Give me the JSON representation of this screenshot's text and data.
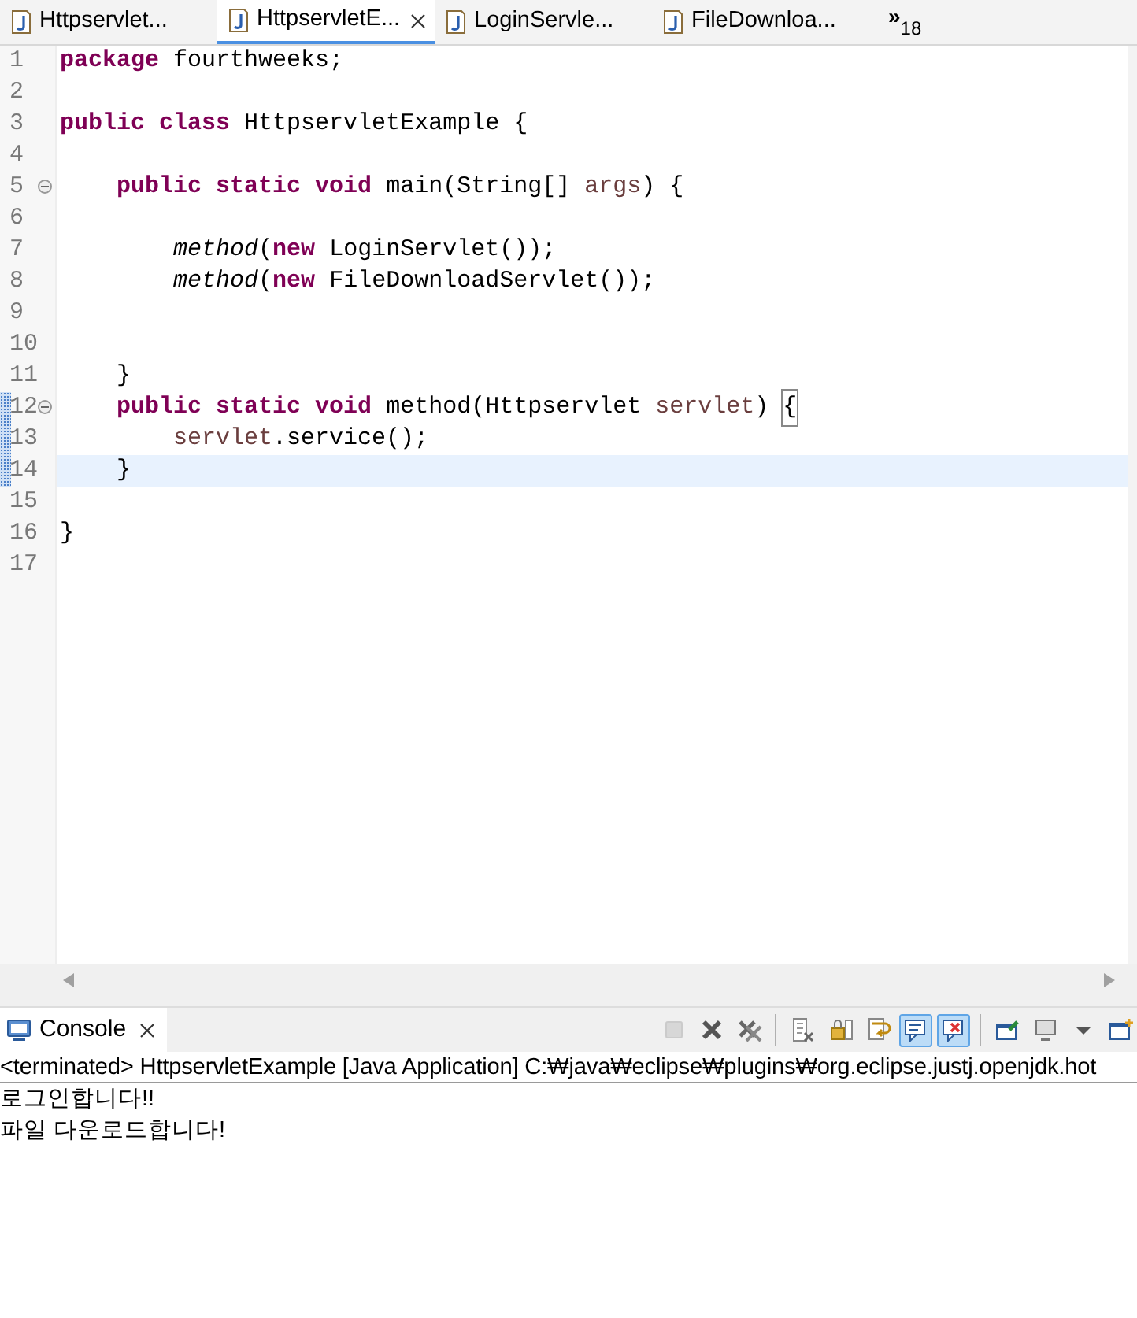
{
  "editor_tabs": [
    {
      "label": "Httpservlet...",
      "selected": false,
      "closable": false
    },
    {
      "label": "HttpservletE...",
      "selected": true,
      "closable": true
    },
    {
      "label": "LoginServle...",
      "selected": false,
      "closable": false
    },
    {
      "label": "FileDownloa...",
      "selected": false,
      "closable": false
    }
  ],
  "overflow": {
    "symbol": "»",
    "count": "18"
  },
  "code_lines": [
    {
      "number": "1",
      "folding": false,
      "current": false,
      "marked": false,
      "segments": [
        {
          "text": "package",
          "kind": "keyword"
        },
        {
          "text": " fourthweeks;",
          "kind": "plain"
        }
      ]
    },
    {
      "number": "2",
      "folding": false,
      "current": false,
      "marked": false
    },
    {
      "number": "3",
      "folding": false,
      "current": false,
      "marked": false,
      "segments": [
        {
          "text": "public class",
          "kind": "keyword"
        },
        {
          "text": " HttpservletExample {",
          "kind": "plain"
        }
      ]
    },
    {
      "number": "4",
      "folding": false,
      "current": false,
      "marked": false
    },
    {
      "number": "5",
      "folding": true,
      "current": false,
      "marked": false,
      "segments": [
        {
          "text": "    public static void",
          "kind": "keyword"
        },
        {
          "text": " main(String[] ",
          "kind": "plain"
        },
        {
          "text": "args",
          "kind": "variable"
        },
        {
          "text": ") {",
          "kind": "plain"
        }
      ]
    },
    {
      "number": "6",
      "folding": false,
      "current": false,
      "marked": false
    },
    {
      "number": "7",
      "folding": false,
      "current": false,
      "marked": false,
      "segments": [
        {
          "text": "        method",
          "kind": "call"
        },
        {
          "text": "(",
          "kind": "plain"
        },
        {
          "text": "new",
          "kind": "keyword"
        },
        {
          "text": " LoginServlet());",
          "kind": "plain"
        }
      ]
    },
    {
      "number": "8",
      "folding": false,
      "current": false,
      "marked": false,
      "segments": [
        {
          "text": "        method",
          "kind": "call"
        },
        {
          "text": "(",
          "kind": "plain"
        },
        {
          "text": "new",
          "kind": "keyword"
        },
        {
          "text": " FileDownloadServlet());",
          "kind": "plain"
        }
      ]
    },
    {
      "number": "9",
      "folding": false,
      "current": false,
      "marked": false
    },
    {
      "number": "10",
      "folding": false,
      "current": false,
      "marked": false
    },
    {
      "number": "11",
      "folding": false,
      "current": false,
      "marked": false,
      "segments": [
        {
          "text": "    }",
          "kind": "plain"
        }
      ]
    },
    {
      "number": "12",
      "folding": true,
      "current": false,
      "marked": true,
      "segments": [
        {
          "text": "    public static void",
          "kind": "keyword"
        },
        {
          "text": " method(Httpservlet ",
          "kind": "plain"
        },
        {
          "text": "servlet",
          "kind": "variable"
        },
        {
          "text": ") ",
          "kind": "plain"
        },
        {
          "text": "{",
          "kind": "bracket-match"
        }
      ]
    },
    {
      "number": "13",
      "folding": false,
      "current": false,
      "marked": true,
      "segments": [
        {
          "text": "        servlet",
          "kind": "variable"
        },
        {
          "text": ".service();",
          "kind": "plain"
        }
      ]
    },
    {
      "number": "14",
      "folding": false,
      "current": true,
      "marked": true,
      "segments": [
        {
          "text": "    }",
          "kind": "plain"
        }
      ]
    },
    {
      "number": "15",
      "folding": false,
      "current": false,
      "marked": false
    },
    {
      "number": "16",
      "folding": false,
      "current": false,
      "marked": false,
      "segments": [
        {
          "text": "}",
          "kind": "plain"
        }
      ]
    },
    {
      "number": "17",
      "folding": false,
      "current": false,
      "marked": false
    }
  ],
  "console": {
    "tab": {
      "label": "Console",
      "selected": true
    },
    "toolbar_groups": [
      [
        {
          "kind": "terminate",
          "disabled": true,
          "pressed": false
        },
        {
          "kind": "remove",
          "disabled": false,
          "pressed": false
        },
        {
          "kind": "remove-all",
          "disabled": false,
          "pressed": false
        }
      ],
      [
        {
          "kind": "clear",
          "disabled": false,
          "pressed": false
        },
        {
          "kind": "scroll-lock",
          "disabled": false,
          "pressed": false
        },
        {
          "kind": "word-wrap",
          "disabled": false,
          "pressed": false
        },
        {
          "kind": "show-on-output",
          "disabled": false,
          "pressed": true
        },
        {
          "kind": "show-on-error",
          "disabled": false,
          "pressed": true
        }
      ],
      [
        {
          "kind": "pin",
          "disabled": false,
          "pressed": false
        },
        {
          "kind": "display",
          "disabled": false,
          "pressed": false
        },
        {
          "kind": "dropdown",
          "disabled": false,
          "pressed": false
        },
        {
          "kind": "new-console",
          "disabled": false,
          "pressed": false
        }
      ]
    ],
    "header": "<terminated> HttpservletExample [Java Application] C:₩java₩eclipse₩plugins₩org.eclipse.justj.openjdk.hot",
    "output": [
      "로그인합니다!!",
      "파일 다운로드합니다!"
    ]
  }
}
